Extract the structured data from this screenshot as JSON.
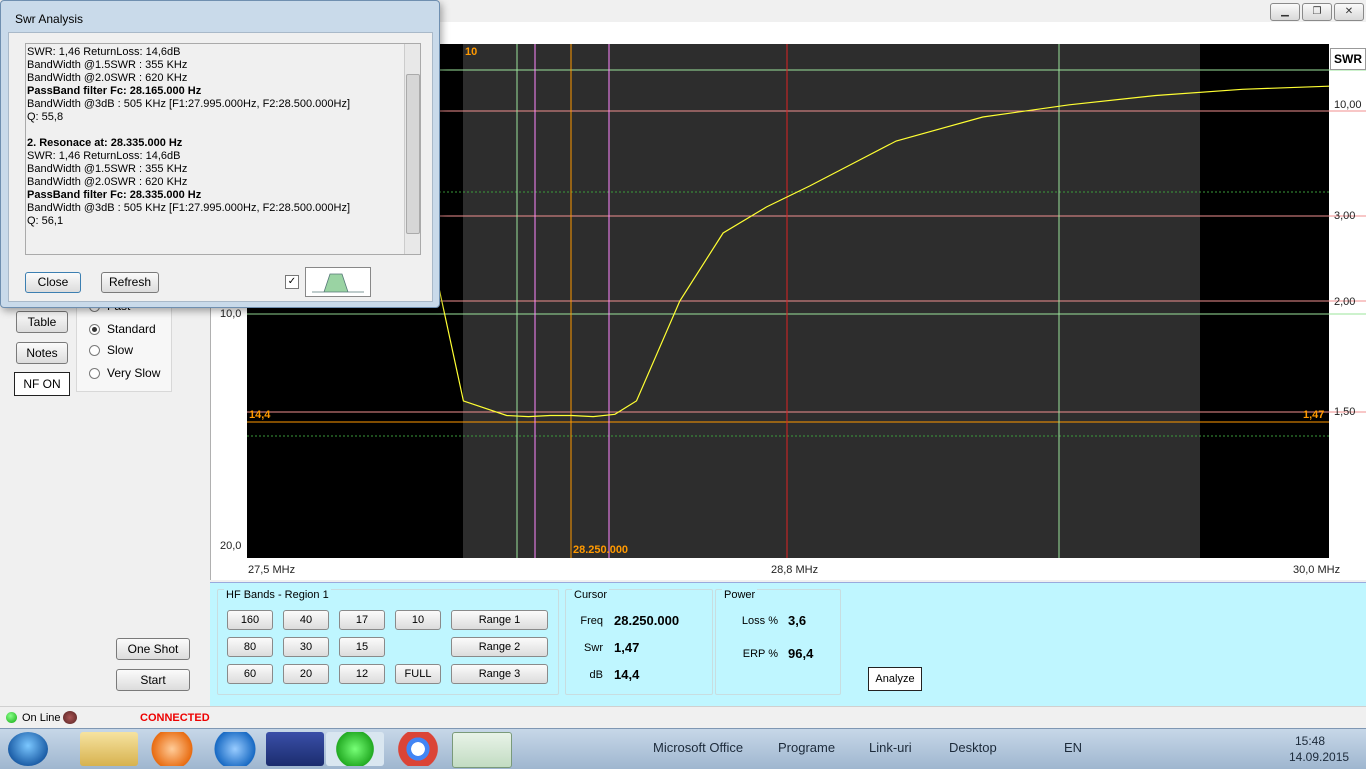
{
  "window": {
    "minimize_glyph": "▁",
    "restore_glyph": "❐",
    "close_glyph": "✕"
  },
  "left": {
    "table_label": "Table",
    "notes_label": "Notes",
    "nf_label": "NF ON",
    "speed_options": [
      {
        "label": "Fast",
        "selected": false
      },
      {
        "label": "Standard",
        "selected": true
      },
      {
        "label": "Slow",
        "selected": false
      },
      {
        "label": "Very Slow",
        "selected": false
      }
    ],
    "one_shot_label": "One Shot",
    "start_label": "Start"
  },
  "chart": {
    "swr_header": "SWR",
    "left_ticks": [
      "10,0",
      "20,0"
    ],
    "right_ticks": [
      "10,00",
      "3,00",
      "2,00",
      "1,50"
    ],
    "x_ticks": [
      "27,5 MHz",
      "28,8 MHz",
      "30,0 MHz"
    ],
    "top_marker": "10",
    "marker_left": "14,4",
    "marker_right": "1,47",
    "cursor_freq_label": "28.250.000"
  },
  "chart_data": {
    "type": "line",
    "xlabel": "",
    "ylabel": "SWR",
    "xlim": [
      27.5,
      30.0
    ],
    "x_tick_labels": [
      "27,5 MHz",
      "28,8 MHz",
      "30,0 MHz"
    ],
    "y_tick_labels_right": [
      "10,00",
      "3,00",
      "2,00",
      "1,50"
    ],
    "y_tick_labels_left": [
      "10,0",
      "20,0"
    ],
    "series": [
      {
        "values_note": "",
        "x": [
          27.5,
          27.9,
          27.95,
          28.0,
          28.1,
          28.15,
          28.2,
          28.25,
          28.3,
          28.35,
          28.4,
          28.5,
          28.6,
          28.7,
          28.8,
          28.9,
          29.0,
          29.2,
          29.4,
          29.6,
          29.8,
          30.0
        ],
        "y": [
          10.0,
          4.0,
          2.0,
          1.55,
          1.47,
          1.46,
          1.47,
          1.47,
          1.46,
          1.48,
          1.55,
          2.0,
          2.8,
          3.6,
          5.0,
          6.5,
          8.0,
          9.6,
          10.2,
          10.5,
          10.7,
          10.8
        ]
      }
    ],
    "cursor": {
      "freq": 28.25,
      "swr": 1.47,
      "db": 14.4
    }
  },
  "bands": {
    "title": "HF Bands - Region 1",
    "row1": [
      "160",
      "40",
      "17",
      "10"
    ],
    "row2": [
      "80",
      "30",
      "15"
    ],
    "row3": [
      "60",
      "20",
      "12",
      "FULL"
    ],
    "ranges": [
      "Range 1",
      "Range 2",
      "Range 3"
    ]
  },
  "cursor": {
    "title": "Cursor",
    "freq_label": "Freq",
    "freq": "28.250.000",
    "swr_label": "Swr",
    "swr": "1,47",
    "db_label": "dB",
    "db": "14,4"
  },
  "power": {
    "title": "Power",
    "loss_label": "Loss %",
    "loss": "3,6",
    "erp_label": "ERP %",
    "erp": "96,4"
  },
  "analyze_label": "Analyze",
  "status": {
    "online": "On Line",
    "connected": "CONNECTED"
  },
  "taskbar": {
    "items": [
      "Microsoft Office",
      "Programe",
      "Link-uri",
      "Desktop"
    ],
    "lang": "EN",
    "time": "15:48",
    "date": "14.09.2015"
  },
  "dialog": {
    "title": "Swr Analysis",
    "lines": [
      {
        "text": "SWR: 1,46 ReturnLoss: 14,6dB",
        "bold": false
      },
      {
        "text": "BandWidth @1.5SWR : 355 KHz",
        "bold": false
      },
      {
        "text": "BandWidth @2.0SWR : 620 KHz",
        "bold": false
      },
      {
        "text": "PassBand filter Fc: 28.165.000 Hz",
        "bold": true
      },
      {
        "text": "BandWidth @3dB : 505 KHz [F1:27.995.000Hz, F2:28.500.000Hz]",
        "bold": false
      },
      {
        "text": "Q: 55,8",
        "bold": false
      },
      {
        "text": "",
        "bold": false
      },
      {
        "text": "2. Resonace at: 28.335.000 Hz",
        "bold": true
      },
      {
        "text": "SWR: 1,46 ReturnLoss: 14,6dB",
        "bold": false
      },
      {
        "text": "BandWidth @1.5SWR : 355 KHz",
        "bold": false
      },
      {
        "text": "BandWidth @2.0SWR : 620 KHz",
        "bold": false
      },
      {
        "text": "PassBand filter Fc: 28.335.000 Hz",
        "bold": true
      },
      {
        "text": "BandWidth @3dB : 505 KHz [F1:27.995.000Hz, F2:28.500.000Hz]",
        "bold": false
      },
      {
        "text": "Q: 56,1",
        "bold": false
      }
    ],
    "close_label": "Close",
    "refresh_label": "Refresh",
    "checkbox_checked": true
  }
}
